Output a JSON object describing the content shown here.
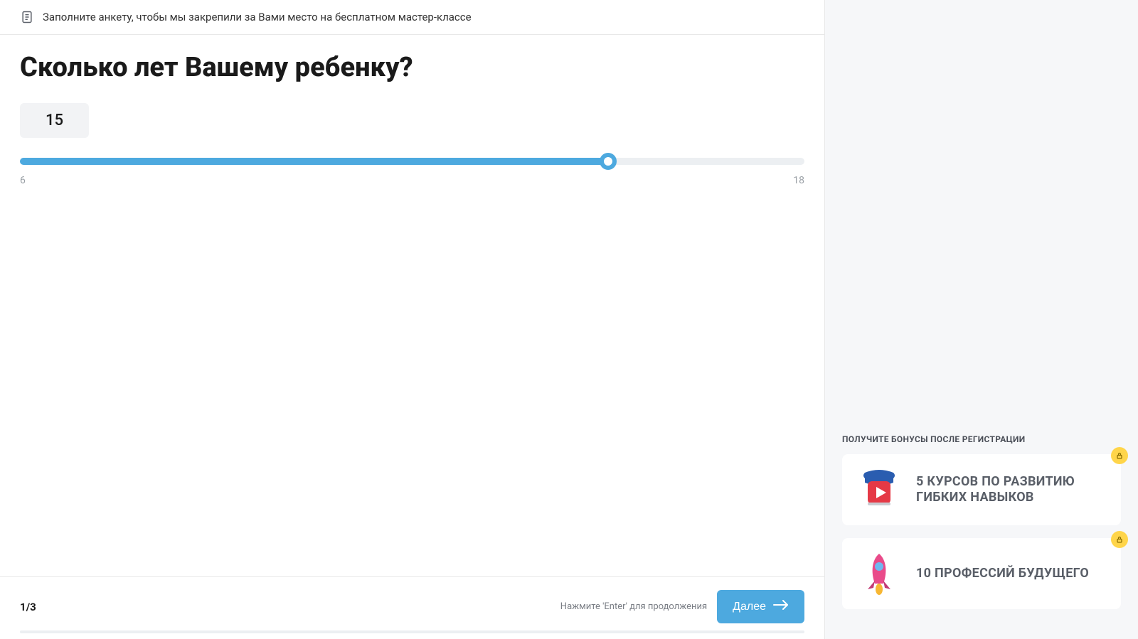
{
  "header": {
    "instruction": "Заполните анкету, чтобы мы закрепили за Вами место на бесплатном мастер-классе"
  },
  "question": {
    "title": "Сколько лет Вашему ребенку?",
    "current_value": "15",
    "min": "6",
    "max": "18",
    "slider_percent": 75
  },
  "footer": {
    "step": "1/3",
    "enter_hint": "Нажмите 'Enter' для продолжения",
    "next_label": "Далее"
  },
  "sidebar": {
    "bonus_heading": "ПОЛУЧИТЕ БОНУСЫ ПОСЛЕ РЕГИСТРАЦИИ",
    "cards": [
      {
        "text": "5 КУРСОВ ПО РАЗВИТИЮ ГИБКИХ НАВЫКОВ"
      },
      {
        "text": "10 ПРОФЕССИЙ БУДУЩЕГО"
      }
    ]
  }
}
